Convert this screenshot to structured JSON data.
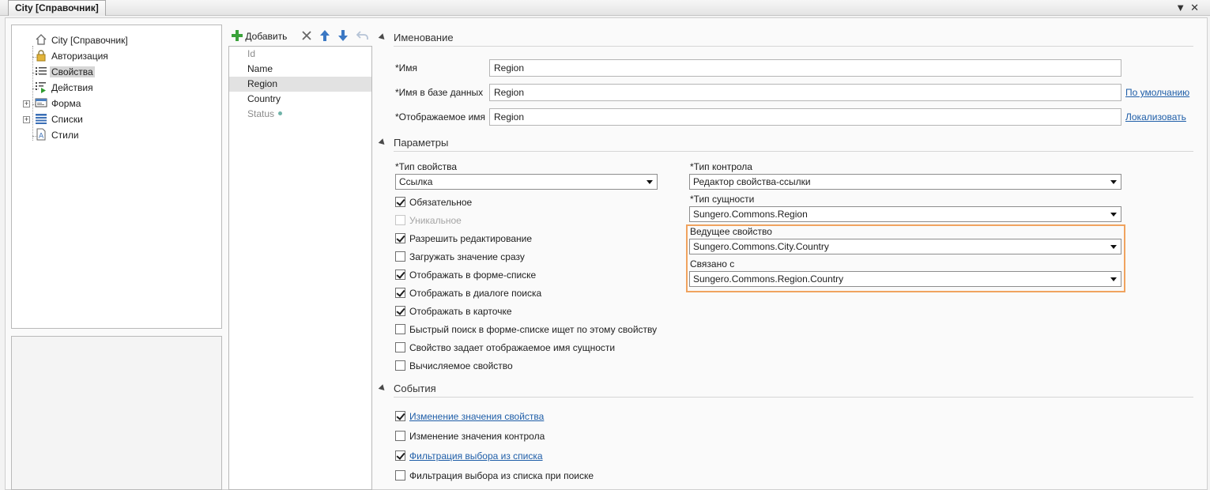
{
  "window": {
    "tab_title": "City [Справочник]"
  },
  "tree": {
    "items": [
      {
        "label": "City [Справочник]",
        "icon": "home-icon"
      },
      {
        "label": "Авторизация",
        "icon": "lock-icon"
      },
      {
        "label": "Свойства",
        "icon": "properties-list-icon",
        "selected": true
      },
      {
        "label": "Действия",
        "icon": "actions-icon"
      },
      {
        "label": "Форма",
        "icon": "form-icon",
        "expandable": true
      },
      {
        "label": "Списки",
        "icon": "lists-icon",
        "expandable": true
      },
      {
        "label": "Стили",
        "icon": "styles-icon"
      }
    ]
  },
  "toolbar": {
    "add_label": "Добавить",
    "add_icon": "plus-icon",
    "delete_icon": "close-icon",
    "up_icon": "arrow-up-icon",
    "down_icon": "arrow-down-icon",
    "undo_icon": "undo-icon"
  },
  "properties": [
    {
      "label": "Id",
      "muted": true
    },
    {
      "label": "Name"
    },
    {
      "label": "Region",
      "selected": true
    },
    {
      "label": "Country"
    },
    {
      "label": "Status",
      "muted": true
    }
  ],
  "naming": {
    "section": "Именование",
    "name_label": "*Имя",
    "name_value": "Region",
    "db_name_label": "*Имя в базе данных",
    "db_name_value": "Region",
    "default_link": "По умолчанию",
    "display_name_label": "*Отображаемое имя",
    "display_name_value": "Region",
    "localize_link": "Локализовать"
  },
  "params": {
    "section": "Параметры",
    "prop_type_label": "*Тип свойства",
    "prop_type_value": "Ссылка",
    "control_type_label": "*Тип контрола",
    "control_type_value": "Редактор свойства-ссылки",
    "entity_type_label": "*Тип сущности",
    "entity_type_value": "Sungero.Commons.Region",
    "leading_prop_label": "Ведущее свойство",
    "leading_prop_value": "Sungero.Commons.City.Country",
    "linked_label": "Связано с",
    "linked_value": "Sungero.Commons.Region.Country",
    "checkboxes": [
      {
        "label": "Обязательное",
        "checked": true,
        "disabled": false
      },
      {
        "label": "Уникальное",
        "checked": false,
        "disabled": true
      },
      {
        "label": "Разрешить редактирование",
        "checked": true,
        "disabled": false
      },
      {
        "label": "Загружать значение сразу",
        "checked": false,
        "disabled": false
      },
      {
        "label": "Отображать в форме-списке",
        "checked": true,
        "disabled": false
      },
      {
        "label": "Отображать в диалоге поиска",
        "checked": true,
        "disabled": false
      },
      {
        "label": "Отображать в карточке",
        "checked": true,
        "disabled": false
      },
      {
        "label": "Быстрый поиск в форме-списке ищет по этому свойству",
        "checked": false,
        "disabled": false
      },
      {
        "label": "Свойство задает отображаемое имя сущности",
        "checked": false,
        "disabled": false
      },
      {
        "label": "Вычисляемое свойство",
        "checked": false,
        "disabled": false
      }
    ]
  },
  "events": {
    "section": "События",
    "items": [
      {
        "label": "Изменение значения свойства",
        "checked": true,
        "link": true
      },
      {
        "label": "Изменение значения контрола",
        "checked": false,
        "link": false
      },
      {
        "label": "Фильтрация выбора из списка",
        "checked": true,
        "link": true
      },
      {
        "label": "Фильтрация выбора из списка при поиске",
        "checked": false,
        "link": false
      }
    ]
  },
  "colors": {
    "accent_link": "#1f5ea8",
    "highlight_border": "#f0a35f",
    "add_green": "#3aa23a",
    "arrow_blue": "#3b78c4"
  }
}
